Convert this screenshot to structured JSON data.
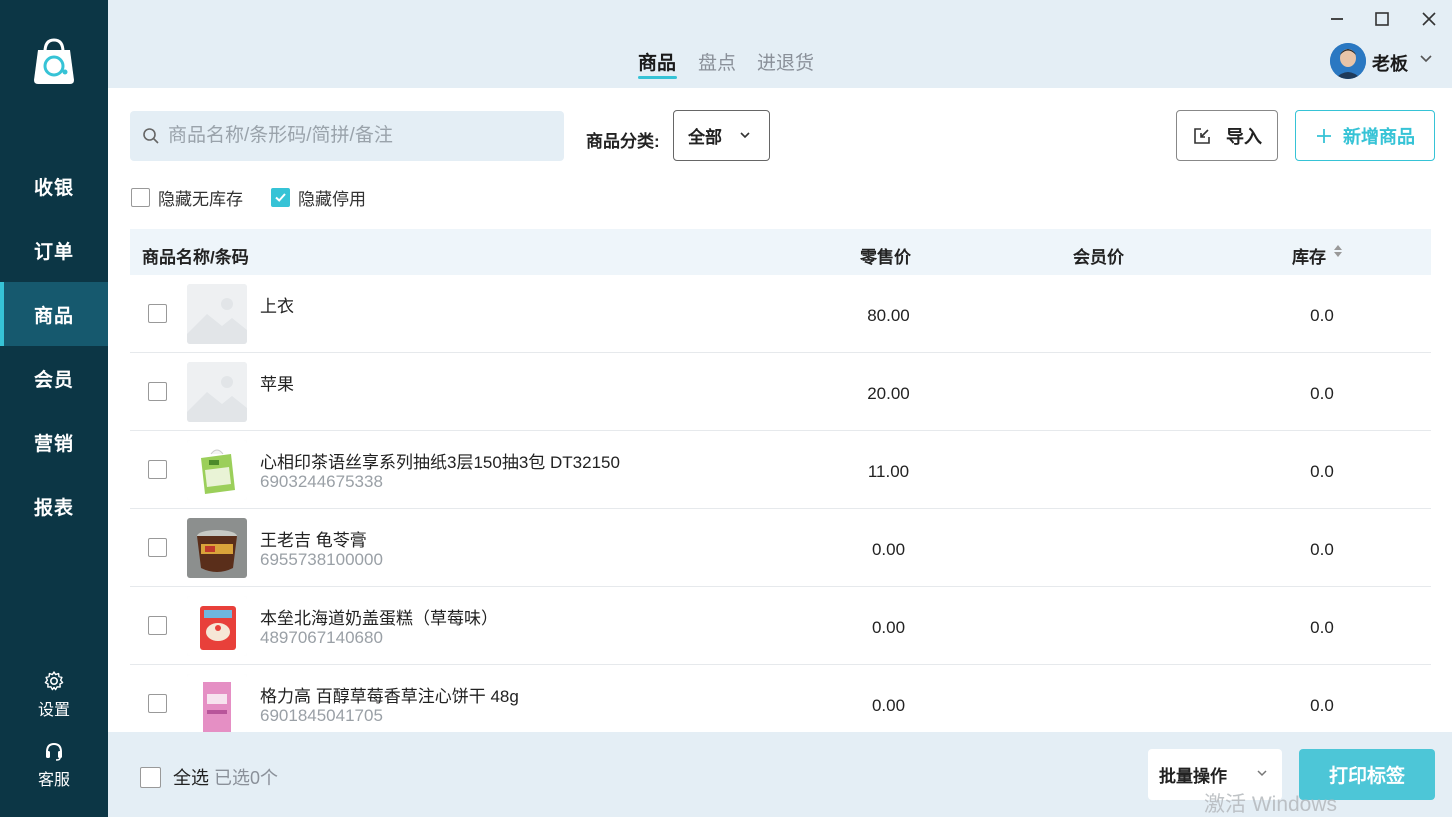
{
  "sidebar": {
    "logo_icon": "shopping-bag-logo-icon",
    "items": [
      {
        "label": "收银",
        "active": false
      },
      {
        "label": "订单",
        "active": false
      },
      {
        "label": "商品",
        "active": true
      },
      {
        "label": "会员",
        "active": false
      },
      {
        "label": "营销",
        "active": false
      },
      {
        "label": "报表",
        "active": false
      }
    ],
    "settings_label": "设置",
    "support_label": "客服"
  },
  "header": {
    "tabs": [
      {
        "label": "商品",
        "active": true
      },
      {
        "label": "盘点",
        "active": false
      },
      {
        "label": "进退货",
        "active": false
      }
    ],
    "user_name": "老板",
    "window_controls": [
      "minimize-icon",
      "maximize-icon",
      "close-icon"
    ]
  },
  "toolbar": {
    "search_placeholder": "商品名称/条形码/简拼/备注",
    "category_label": "商品分类:",
    "category_value": "全部",
    "import_label": "导入",
    "add_label": "新增商品"
  },
  "filters": [
    {
      "label": "隐藏无库存",
      "checked": false
    },
    {
      "label": "隐藏停用",
      "checked": true
    }
  ],
  "table": {
    "columns": [
      "商品名称/条码",
      "零售价",
      "会员价",
      "库存"
    ],
    "rows": [
      {
        "name": "上衣",
        "barcode": "",
        "price": "80.00",
        "member_price": "",
        "stock": "0.0",
        "thumb": "placeholder"
      },
      {
        "name": "苹果",
        "barcode": "",
        "price": "20.00",
        "member_price": "",
        "stock": "0.0",
        "thumb": "placeholder"
      },
      {
        "name": "心相印茶语丝享系列抽纸3层150抽3包 DT32150",
        "barcode": "6903244675338",
        "price": "11.00",
        "member_price": "",
        "stock": "0.0",
        "thumb": "tissue"
      },
      {
        "name": "王老吉 龟苓膏",
        "barcode": "6955738100000",
        "price": "0.00",
        "member_price": "",
        "stock": "0.0",
        "thumb": "jelly"
      },
      {
        "name": "本垒北海道奶盖蛋糕（草莓味）",
        "barcode": "4897067140680",
        "price": "0.00",
        "member_price": "",
        "stock": "0.0",
        "thumb": "cake"
      },
      {
        "name": "格力高 百醇草莓香草注心饼干 48g",
        "barcode": "6901845041705",
        "price": "0.00",
        "member_price": "",
        "stock": "0.0",
        "thumb": "biscuit"
      }
    ]
  },
  "footer": {
    "select_all_label": "全选",
    "selected_count": "已选0个",
    "batch_label": "批量操作",
    "print_label": "打印标签",
    "watermark": "激活 Windows"
  },
  "colors": {
    "sidebar_bg": "#0c3645",
    "sidebar_active": "#16596e",
    "accent": "#36c3d6",
    "header_bg": "#e4eef5",
    "print_button": "#4dc6d7"
  }
}
